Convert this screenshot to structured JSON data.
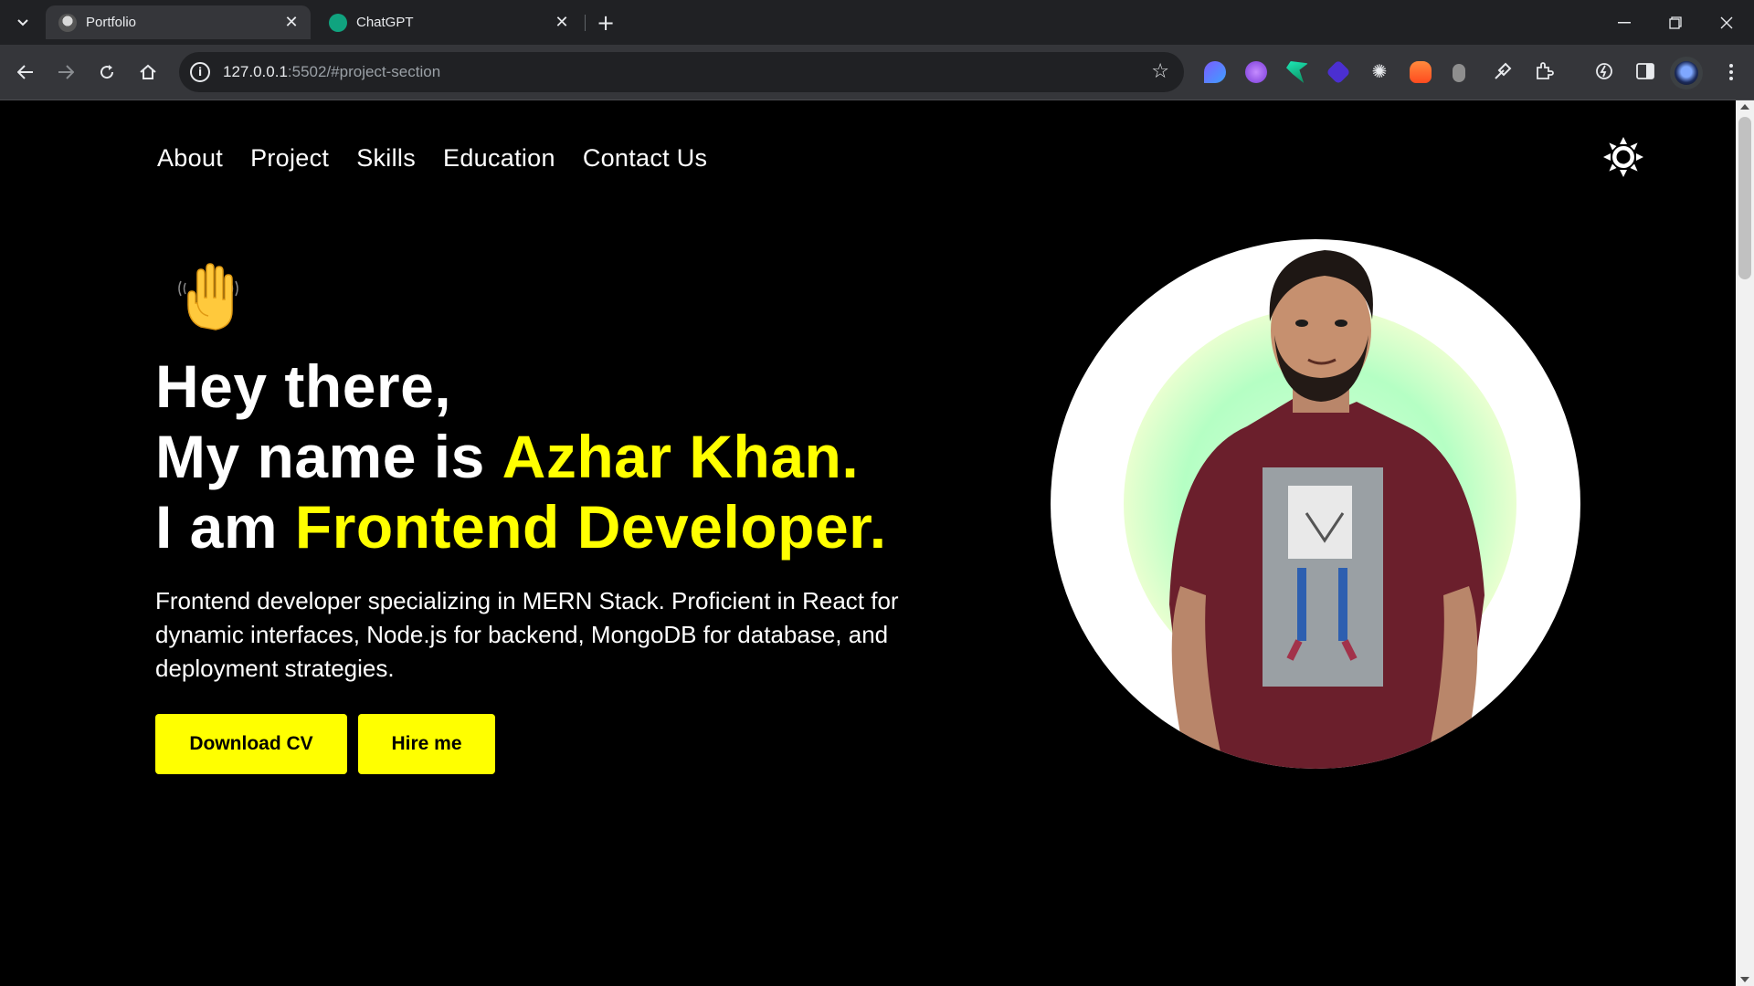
{
  "browser": {
    "tabs": [
      {
        "title": "Portfolio",
        "active": true,
        "close": "✕"
      },
      {
        "title": "ChatGPT",
        "active": false,
        "close": "✕"
      }
    ],
    "new_tab": "+",
    "tab_search": "⌄",
    "window_controls": {
      "minimize": "—",
      "restore": "❐",
      "close": "✕"
    },
    "url_host": "127.0.0.1",
    "url_path": ":5502/#project-section",
    "bookmark_icon": "☆",
    "extension_icons": [
      "droplet-icon",
      "planet-icon",
      "leaf-icon",
      "cube-icon",
      "gear-icon",
      "fire-icon",
      "bulb-icon",
      "eyedropper-icon",
      "puzzle-icon",
      "performance-icon",
      "sidepanel-icon"
    ]
  },
  "nav": {
    "items": [
      "About",
      "Project",
      "Skills",
      "Education",
      "Contact Us"
    ]
  },
  "hero": {
    "wave_emoji": "✋",
    "line1": "Hey there,",
    "line2_prefix": "My name is ",
    "name": "Azhar Khan.",
    "line3_prefix": "I am ",
    "role": "Frontend Developer.",
    "intro": "Frontend developer specializing in MERN Stack. Proficient in React for dynamic interfaces, Node.js for backend, MongoDB for database, and deployment strategies.",
    "buttons": {
      "download": "Download CV",
      "hire": "Hire me"
    }
  },
  "colors": {
    "accent": "#ffff00",
    "background": "#000000",
    "text": "#ffffff",
    "portrait_glow": "#b5ffc4",
    "shirt": "#6b1f2c"
  }
}
